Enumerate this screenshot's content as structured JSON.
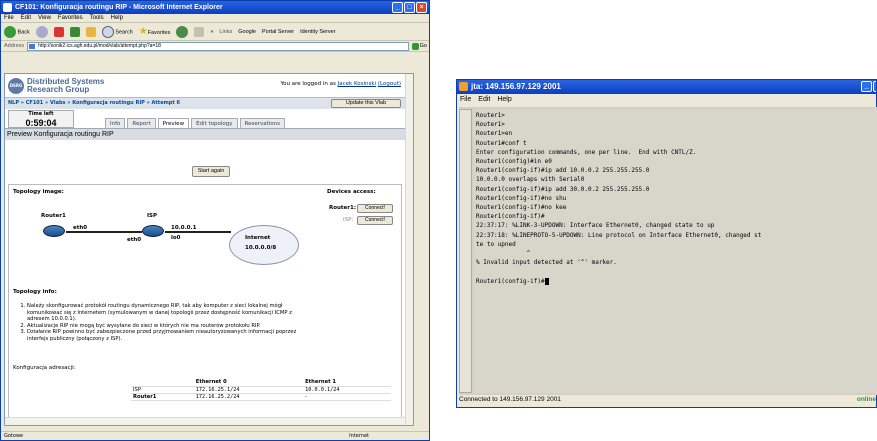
{
  "ie": {
    "title": "CF101: Konfiguracja routingu RIP - Microsoft Internet Explorer",
    "menu": [
      "File",
      "Edit",
      "View",
      "Favorites",
      "Tools",
      "Help"
    ],
    "toolbar": {
      "back": "Back",
      "search": "Search",
      "favorites": "Favorites",
      "links": "Links",
      "google": "Google",
      "portal": "Portal Server",
      "identity": "Identity Server"
    },
    "address_label": "Address",
    "address": "http://sonik2.ics.agh.edu.pl/mod/vlab/attempt.php?a=18",
    "go": "Go",
    "status_left": "Gotowe",
    "status_right": "Internet"
  },
  "page": {
    "brand_line1": "Distributed Systems",
    "brand_line2": "Research Group",
    "logo": "DSRG",
    "logged_prefix": "You are logged in as",
    "logged_user": "Jacek Kosinski",
    "logout": "(Logout)",
    "breadcrumb": "NLP » CF101 » Vlabs » Konfiguracja routingu RIP » Attempt 6",
    "update_button": "Update this Vlab",
    "time_left_label": "Time left",
    "time_left": "0:59:04",
    "tabs": [
      "Info",
      "Report",
      "Preview",
      "Edit topology",
      "Reservations"
    ],
    "preview_title": "Preview Konfiguracja routingu RIP",
    "start_again": "Start again",
    "topology_label": "Topology image:",
    "devices_label": "Devices access:",
    "router1": "Router1",
    "isp": "ISP",
    "internet": "Internet",
    "internet_net": "10.0.0.0/8",
    "eth0a": "eth0",
    "eth0b": "eth0",
    "ip_isp": "10.0.0.1",
    "lo0": "lo0",
    "dev1": "Router1:",
    "dev2": "ISP:",
    "connect": "Connect!",
    "topology_info_label": "Topology info:",
    "info_items": [
      "Należy skonfigurować protokół routingu dynamicznego RIP, tak aby komputer z sieci lokalnej mógł komunikować się z Internetem (symulowanym w danej topologii przez dostępność komunikacji ICMP z adresem 10.0.0.1).",
      "Aktualizacje RIP nie mogą być wysyłane do sieci w których nie ma routerów protokołu RIP.",
      "Działanie RIP powinno być zabezpieczone przed przyjmowaniem nieautoryzowanych informacji poprzez interfejs publiczny (połączony z ISP)."
    ],
    "addr_config_label": "Konfiguracja adresacji:",
    "table": {
      "headers": [
        "",
        "Ethernet 0",
        "Ethernet 1"
      ],
      "rows": [
        [
          "ISP",
          "172.16.25.1/24",
          "10.0.0.1/24"
        ],
        [
          "Router1",
          "172.16.25.2/24",
          "-"
        ]
      ]
    }
  },
  "terminal": {
    "title": "jta: 149.156.97.129 2001",
    "menu": [
      "File",
      "Edit",
      "Help"
    ],
    "lines": [
      "Router1>",
      "Router1>",
      "Router1>en",
      "Router1#conf t",
      "Enter configuration commands, one per line.  End with CNTL/Z.",
      "Router1(config)#in e0",
      "Router1(config-if)#ip add 10.0.0.2 255.255.255.0",
      "10.0.0.0 overlaps with Serial0",
      "Router1(config-if)#ip add 30.0.0.2 255.255.255.0",
      "Router1(config-if)#no shu",
      "Router1(config-if)#no kee",
      "Router1(config-if)#",
      "22:37:17: %LINK-3-UPDOWN: Interface Ethernet0, changed state to up",
      "22:37:18: %LINEPROTO-5-UPDOWN: Line protocol on Interface Ethernet0, changed st",
      "te to upned",
      "              ^",
      "% Invalid input detected at '^' marker.",
      "",
      "Router1(config-if)#"
    ],
    "status": "Connected to 149.156.97.129 2001",
    "online": "online"
  },
  "colors": {
    "xp_blue": "#0a3fc0",
    "online": "#2a9c2a",
    "link": "#003399"
  }
}
